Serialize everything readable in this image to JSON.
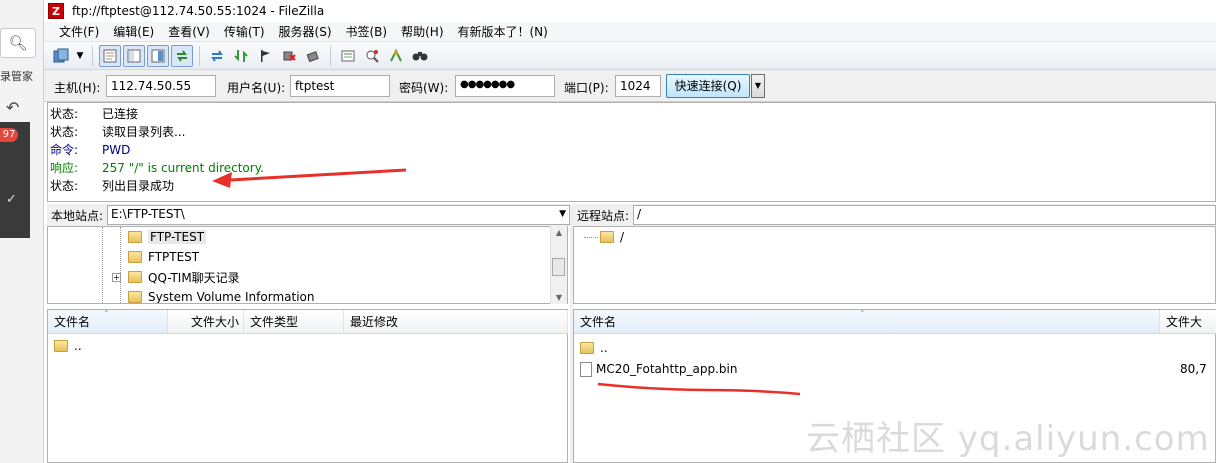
{
  "left_strip": {
    "label": "录管家",
    "badge": "97"
  },
  "window": {
    "title": "ftp://ftptest@112.74.50.55:1024 - FileZilla",
    "app_icon": "Z"
  },
  "menu": [
    "文件(F)",
    "编辑(E)",
    "查看(V)",
    "传输(T)",
    "服务器(S)",
    "书签(B)",
    "帮助(H)",
    "有新版本了！(N)"
  ],
  "toolbar_icons": [
    "site-manager-icon",
    "dropdown-icon",
    "toggle-log-icon",
    "toggle-local-tree-icon",
    "toggle-remote-tree-icon",
    "toggle-queue-icon",
    "refresh-icon",
    "process-queue-icon",
    "cancel-icon",
    "disconnect-icon",
    "reconnect-icon",
    "filter-icon",
    "compare-icon",
    "sync-browse-icon",
    "search-icon"
  ],
  "quickconnect": {
    "host_label": "主机(H):",
    "host_value": "112.74.50.55",
    "user_label": "用户名(U):",
    "user_value": "ftptest",
    "pass_label": "密码(W):",
    "pass_value": "●●●●●●●",
    "port_label": "端口(P):",
    "port_value": "1024",
    "button_label": "快速连接(Q)"
  },
  "log": [
    {
      "type": "状态:",
      "msg": "已连接",
      "color": "#000000"
    },
    {
      "type": "状态:",
      "msg": "读取目录列表...",
      "color": "#000000"
    },
    {
      "type": "命令:",
      "msg": "PWD",
      "color": "#000080"
    },
    {
      "type": "响应:",
      "msg": "257 \"/\" is current directory.",
      "color": "#008000"
    },
    {
      "type": "状态:",
      "msg": "列出目录成功",
      "color": "#000000"
    }
  ],
  "local": {
    "site_label": "本地站点:",
    "path": "E:\\FTP-TEST\\",
    "tree": [
      "FTP-TEST",
      "FTPTEST",
      "QQ-TIM聊天记录",
      "System Volume Information"
    ],
    "columns": [
      "文件名",
      "文件大小",
      "文件类型",
      "最近修改"
    ],
    "files": [
      ".."
    ]
  },
  "remote": {
    "site_label": "远程站点:",
    "path": "/",
    "tree": [
      "/"
    ],
    "columns": [
      "文件名",
      "文件大"
    ],
    "files": [
      {
        "name": "..",
        "size": ""
      },
      {
        "name": "MC20_Fotahttp_app.bin",
        "size": "80,7"
      }
    ]
  },
  "watermark": "云栖社区 yq.aliyun.com",
  "colors": {
    "annotation_red": "#e8302a",
    "accent": "#3c7fb1"
  }
}
